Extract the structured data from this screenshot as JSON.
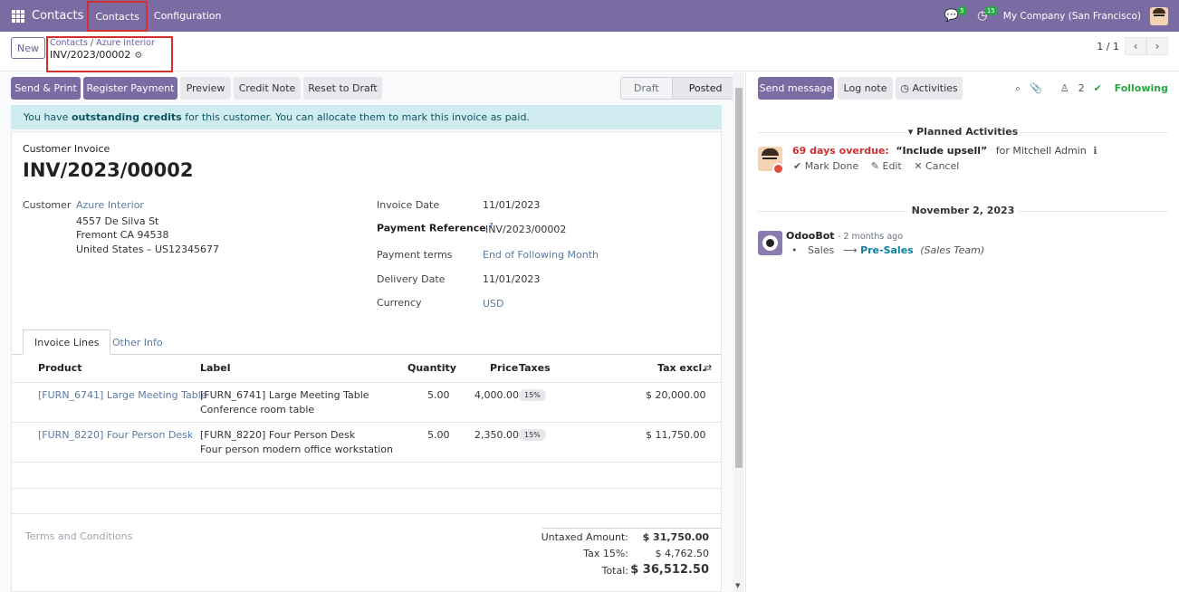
{
  "navbar": {
    "app_name": "Contacts",
    "menu": [
      "Contacts",
      "Configuration"
    ],
    "messages_count": "5",
    "activities_count": "15",
    "company": "My Company (San Francisco)"
  },
  "control": {
    "new_label": "New",
    "breadcrumb": [
      "Contacts",
      "Azure Interior"
    ],
    "current_record": "INV/2023/00002",
    "pager": "1 / 1"
  },
  "actions": {
    "send_print": "Send & Print",
    "register_payment": "Register Payment",
    "preview": "Preview",
    "credit_note": "Credit Note",
    "reset_draft": "Reset to Draft"
  },
  "status": {
    "steps": [
      "Draft",
      "Posted"
    ],
    "active": "Posted"
  },
  "alert": {
    "prefix": "You have ",
    "bold": "outstanding credits",
    "suffix": " for this customer. You can allocate them to mark this invoice as paid."
  },
  "invoice": {
    "type": "Customer Invoice",
    "number": "INV/2023/00002",
    "customer_label": "Customer",
    "customer_name": "Azure Interior",
    "address": [
      "4557 De Silva St",
      "Fremont CA 94538",
      "United States – US12345677"
    ],
    "invoice_date_label": "Invoice Date",
    "invoice_date": "11/01/2023",
    "payment_ref_label": "Payment Reference",
    "payment_ref_help": "?",
    "payment_ref": "INV/2023/00002",
    "payment_terms_label": "Payment terms",
    "payment_terms": "End of Following Month",
    "delivery_date_label": "Delivery Date",
    "delivery_date": "11/01/2023",
    "currency_label": "Currency",
    "currency": "USD"
  },
  "tabs": [
    "Invoice Lines",
    "Other Info"
  ],
  "table": {
    "headers": {
      "product": "Product",
      "label": "Label",
      "quantity": "Quantity",
      "price": "Price",
      "taxes": "Taxes",
      "tax_excl": "Tax excl."
    },
    "rows": [
      {
        "product": "[FURN_6741] Large Meeting Table",
        "label1": "[FURN_6741] Large Meeting Table",
        "label2": "Conference room table",
        "quantity": "5.00",
        "price": "4,000.00",
        "tax": "15%",
        "subtotal": "$ 20,000.00"
      },
      {
        "product": "[FURN_8220] Four Person Desk",
        "label1": "[FURN_8220] Four Person Desk",
        "label2": "Four person modern office workstation",
        "quantity": "5.00",
        "price": "2,350.00",
        "tax": "15%",
        "subtotal": "$ 11,750.00"
      }
    ]
  },
  "footer": {
    "terms": "Terms and Conditions",
    "untaxed_label": "Untaxed Amount:",
    "untaxed": "$ 31,750.00",
    "tax_label": "Tax 15%:",
    "tax": "$ 4,762.50",
    "total_label": "Total:",
    "total": "$ 36,512.50"
  },
  "chatter": {
    "send_message": "Send message",
    "log_note": "Log note",
    "activities": "Activities",
    "followers_count": "2",
    "following": "Following",
    "planned_title": "Planned Activities",
    "activity": {
      "overdue": "69 days overdue:",
      "summary": "“Include upsell”",
      "assignee": "for Mitchell Admin",
      "mark_done": "Mark Done",
      "edit": "Edit",
      "cancel": "Cancel"
    },
    "date_sep": "November 2, 2023",
    "message": {
      "author": "OdooBot",
      "time": "- 2 months ago",
      "field": "Sales",
      "new_value": "Pre-Sales",
      "field_desc": "(Sales Team)"
    }
  }
}
